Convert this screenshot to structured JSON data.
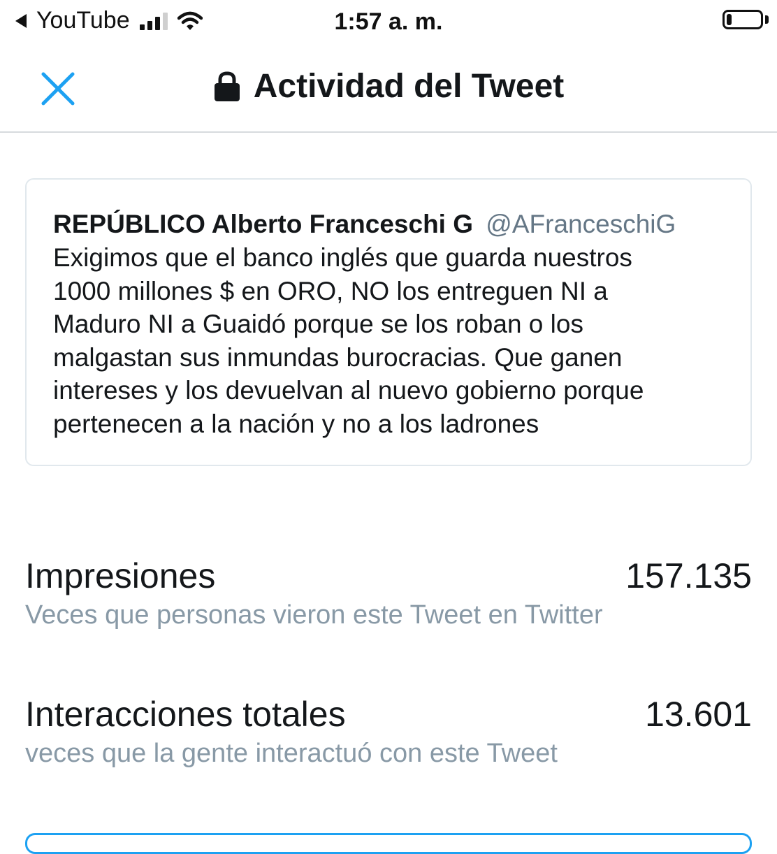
{
  "status_bar": {
    "back_app": "YouTube",
    "time": "1:57 a. m.",
    "signal_bars": 3,
    "signal_total": 4,
    "battery_level": 0.15
  },
  "nav": {
    "title": "Actividad del Tweet",
    "close_icon": "close-icon",
    "lock_icon": "lock-icon",
    "accent": "#1da1f2"
  },
  "tweet": {
    "author_name": "REPÚBLICO Alberto Franceschi G",
    "author_handle": "@AFranceschiG",
    "text": "Exigimos que el banco inglés que guarda nuestros\n1000 millones $ en ORO,  NO los entreguen NI a\nMaduro NI a Guaidó porque se los roban o los\nmalgastan sus inmundas burocracias. Que ganen\nintereses y los devuelvan al nuevo gobierno porque\npertenecen a la nación y no a los ladrones"
  },
  "metrics": [
    {
      "label": "Impresiones",
      "value": "157.135",
      "description": "Veces que personas vieron este Tweet en Twitter"
    },
    {
      "label": "Interacciones totales",
      "value": "13.601",
      "description": "veces que la gente interactuó con este Tweet"
    }
  ]
}
